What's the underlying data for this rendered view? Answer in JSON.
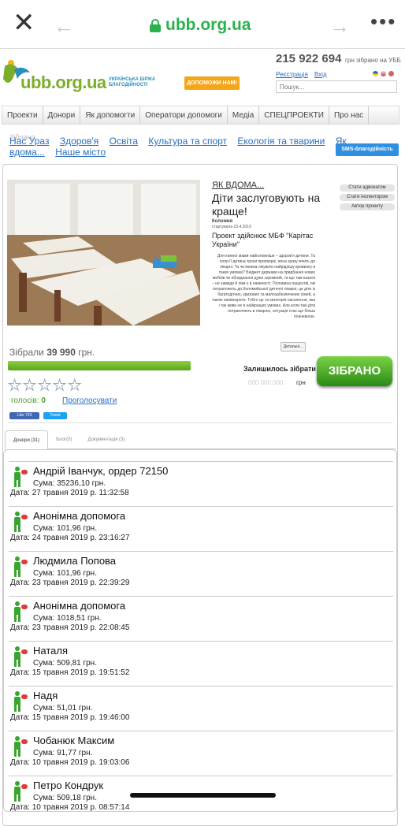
{
  "browser": {
    "close_glyph": "✕",
    "back_glyph": "←",
    "forward_glyph": "→",
    "more_glyph": "•••",
    "url": "ubb.org.ua"
  },
  "header": {
    "logo_text": "ubb.org.ua",
    "logo_sub": "УКРАЇНСЬКА БІРЖА БЛАГОДІЙНОСТІ",
    "donate_button": "ДОПОМОЖИ НАМ!",
    "phone": "215 922 694",
    "phone_note": "грн зібрано на УББ",
    "register_link": "Реєстрація",
    "login_link": "Вхід",
    "search_placeholder": "Пошук..."
  },
  "nav": {
    "items": [
      "Проекти",
      "Донори",
      "Як допомогти",
      "Оператори допомоги",
      "Медіа",
      "СПЕЦПРОЕКТИ",
      "Про нас"
    ]
  },
  "categories": {
    "overlay": "Зібрано",
    "items": [
      "Нас Ураз",
      "Здоров'я",
      "Освіта",
      "Культура та спорт",
      "Екологія та тварини",
      "Як вдома...",
      "Наше місто"
    ],
    "sms_button": "SMS-благодійність"
  },
  "project": {
    "tag": "ЯК ВДОМА...",
    "title": "Діти заслуговують на краще!",
    "city": "Коломия",
    "start_date": "стартувала 23.4.2019",
    "org_label": "Проект здійснює МБФ \"Карітас України\"",
    "description": "Для кожної мами найголовніше – здоров'я дитини. Та коли її дитина трохи прихворіє, вона зразу мчить до лікарні. Та чи можна лікувати найріднішу кровинку в таких умовах? Бюджет держави на придбання нових меблів чи обладнання дуже скромний, та що там казати – не завжди й ліки є в наявності. Половина пацієнтів, які потрапляють до Коломийської дитячої лікарні, це діти із багатодітних, кризових та малозабезпечених сімей, а також напівсироти. Тобто це та категорія населення, яка і так живе не в найкращих умовах. Але коли такі діти потрапляють в лікарню, ситуація стає ще більш плачевною.",
    "details_button": "Детальні...",
    "side_buttons": [
      "Стати адвокатом",
      "Стати інспектором",
      "Автор проекту"
    ],
    "raised_label": "Зібрали",
    "raised_value": "39 990",
    "raised_unit": "грн.",
    "progress_fraction": 0.95,
    "remaining_label": "Залишилось зібрати",
    "remaining_value": "000 000 000",
    "remaining_currency": "грн",
    "done_button": "ЗІБРАНО",
    "rating_stars_filled": 0,
    "rating_stars_total": 5,
    "votes_label": "голосів:",
    "votes_count": "0",
    "vote_link": "Проголосувати",
    "fb_like": "Like 723",
    "tweet": "Tweet"
  },
  "tabs": [
    {
      "label": "Донори (31)",
      "active": true
    },
    {
      "label": "Блог(0)",
      "active": false
    },
    {
      "label": "Документація (3)",
      "active": false
    }
  ],
  "donors": [
    {
      "name": "Андрій Іванчук, ордер 72150",
      "sum": "Сума: 35236,10 грн.",
      "date": "Дата: 27 травня 2019 р. 11:32:58"
    },
    {
      "name": "Анонімна допомога",
      "sum": "Сума: 101,96 грн.",
      "date": "Дата: 24 травня 2019 р. 23:16:27"
    },
    {
      "name": "Людмила Попова",
      "sum": "Сума: 101,96 грн.",
      "date": "Дата: 23 травня 2019 р. 22:39:29"
    },
    {
      "name": "Анонімна допомога",
      "sum": "Сума: 1018,51 грн.",
      "date": "Дата: 23 травня 2019 р. 22:08:45"
    },
    {
      "name": "Наталя",
      "sum": "Сума: 509,81 грн.",
      "date": "Дата: 15 травня 2019 р. 19:51:52"
    },
    {
      "name": "Надя",
      "sum": "Сума: 51,01 грн.",
      "date": "Дата: 15 травня 2019 р. 19:46:00"
    },
    {
      "name": "Чобанюк Максим",
      "sum": "Сума: 91,77 грн.",
      "date": "Дата: 10 травня 2019 р. 19:03:06"
    },
    {
      "name": "Петро Кондрук",
      "sum": "Сума: 509,18 грн.",
      "date": "Дата: 10 травня 2019 р. 08:57:14"
    }
  ]
}
